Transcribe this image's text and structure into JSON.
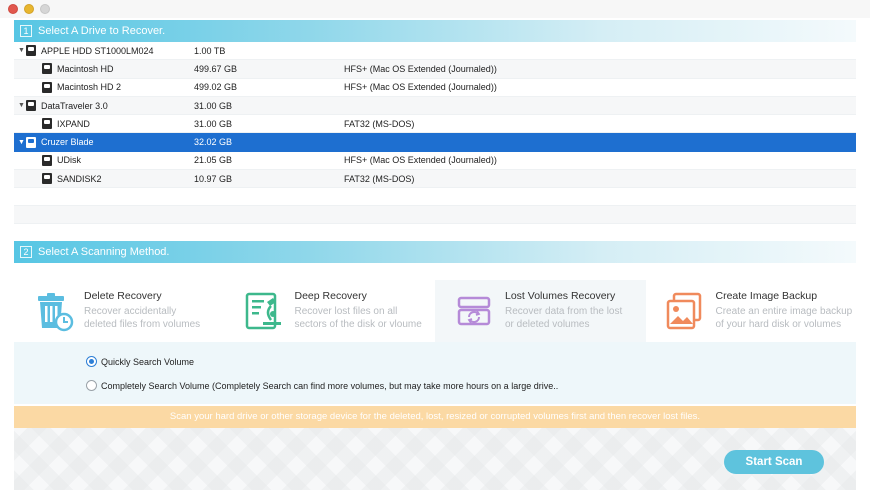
{
  "section1": {
    "num": "1",
    "title": "Select A Drive to Recover."
  },
  "section2": {
    "num": "2",
    "title": "Select A Scanning Method."
  },
  "drives": [
    {
      "level": 0,
      "name": "APPLE HDD ST1000LM024",
      "size": "1.00 TB",
      "fs": "",
      "expanded": true
    },
    {
      "level": 1,
      "name": "Macintosh HD",
      "size": "499.67 GB",
      "fs": "HFS+ (Mac OS Extended (Journaled))"
    },
    {
      "level": 1,
      "name": "Macintosh HD 2",
      "size": "499.02 GB",
      "fs": "HFS+ (Mac OS Extended (Journaled))"
    },
    {
      "level": 0,
      "name": "DataTraveler 3.0",
      "size": "31.00 GB",
      "fs": "",
      "expanded": true
    },
    {
      "level": 1,
      "name": "IXPAND",
      "size": "31.00 GB",
      "fs": "FAT32 (MS-DOS)"
    },
    {
      "level": 0,
      "name": "Cruzer Blade",
      "size": "32.02 GB",
      "fs": "",
      "expanded": true,
      "selected": true
    },
    {
      "level": 1,
      "name": "UDisk",
      "size": "21.05 GB",
      "fs": "HFS+ (Mac OS Extended (Journaled))"
    },
    {
      "level": 1,
      "name": "SANDISK2",
      "size": "10.97 GB",
      "fs": "FAT32 (MS-DOS)"
    }
  ],
  "methods": [
    {
      "title": "Delete Recovery",
      "desc1": "Recover accidentally",
      "desc2": "deleted files from volumes",
      "icon": "trash-clock-icon",
      "color": "#5bbde0"
    },
    {
      "title": "Deep Recovery",
      "desc1": "Recover lost files on all",
      "desc2": "sectors of the disk or vloume",
      "icon": "document-microscope-icon",
      "color": "#3db88c"
    },
    {
      "title": "Lost Volumes Recovery",
      "desc1": "Recover data from the lost",
      "desc2": "or deleted volumes",
      "icon": "drive-refresh-icon",
      "color": "#b58ad8"
    },
    {
      "title": "Create Image Backup",
      "desc1": "Create an entire image backup",
      "desc2": "of your hard disk or volumes",
      "icon": "image-backup-icon",
      "color": "#f08a5c"
    }
  ],
  "options": {
    "quick": "Quickly Search Volume",
    "complete": "Completely Search Volume (Completely Search can find more volumes, but may take more hours on a large drive.."
  },
  "banner": "Scan your hard drive or other storage device for the deleted, lost, resized or corrupted volumes first and then recover lost files.",
  "start_button": "Start Scan"
}
